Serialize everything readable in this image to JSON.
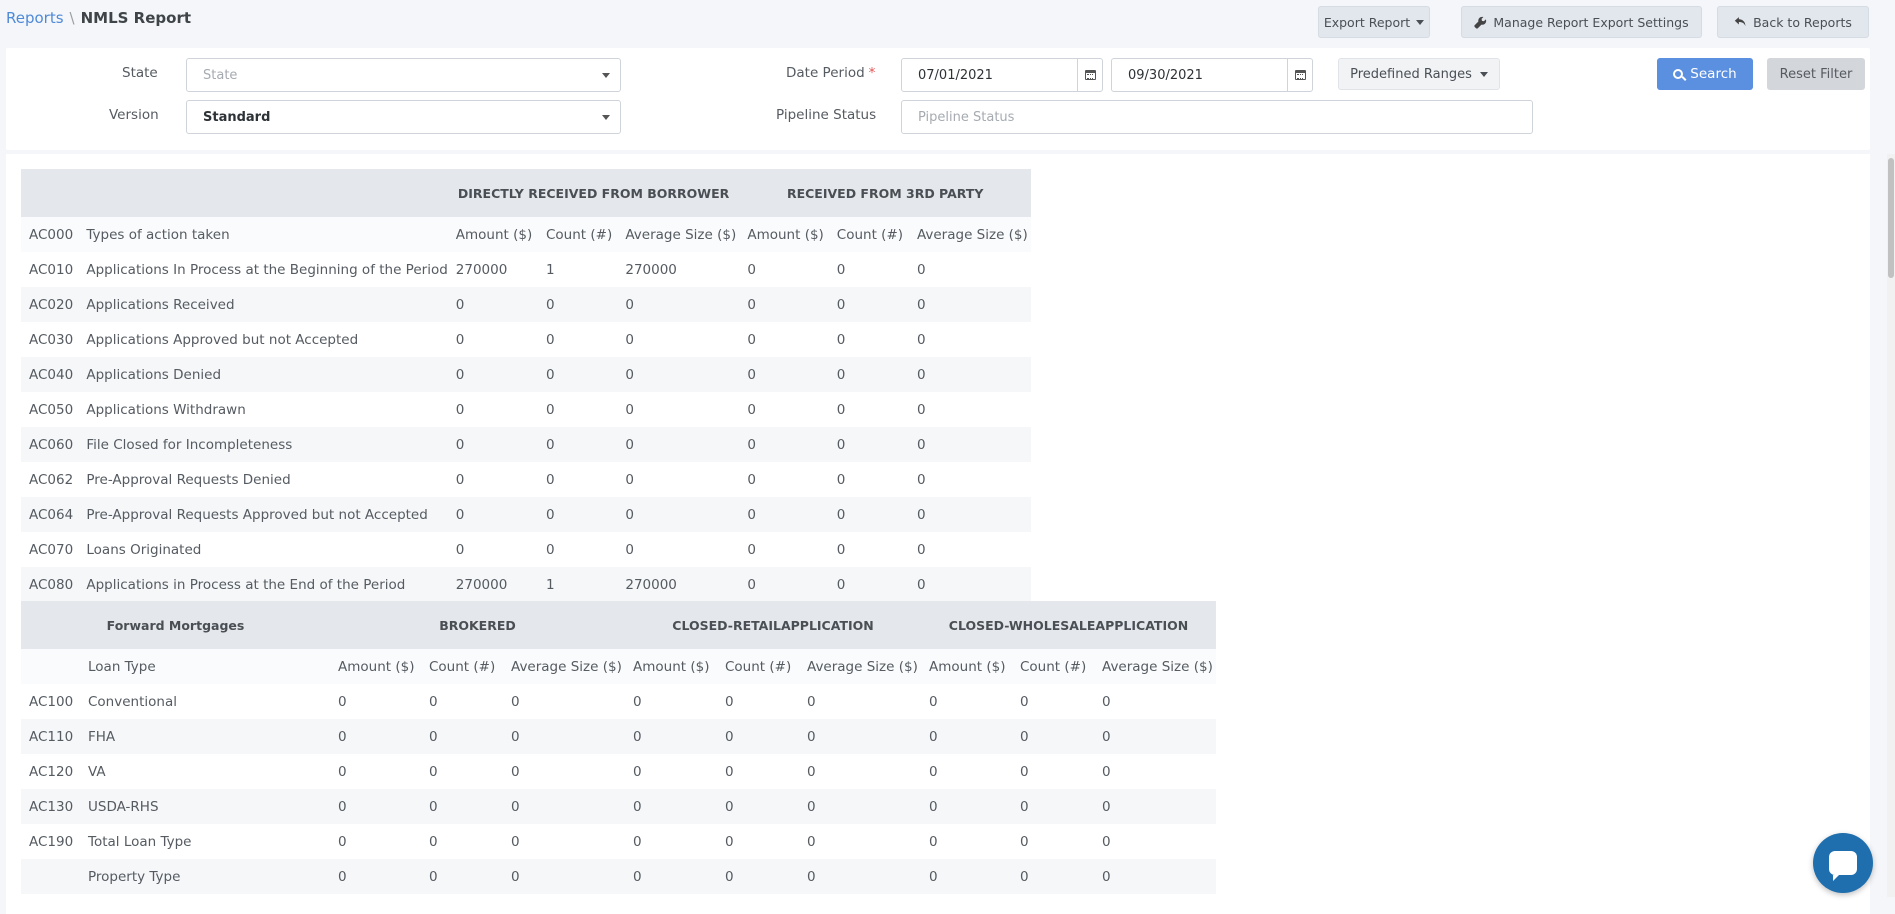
{
  "breadcrumb": {
    "parent": "Reports",
    "separator": "\\",
    "current": "NMLS Report"
  },
  "header_buttons": {
    "export": "Export Report",
    "manage": "Manage Report Export Settings",
    "back": "Back to Reports"
  },
  "filters": {
    "state_label": "State",
    "state_placeholder": "State",
    "version_label": "Version",
    "version_value": "Standard",
    "date_label": "Date Period",
    "date_required": "*",
    "date_from": "07/01/2021",
    "date_to": "09/30/2021",
    "ranges_label": "Predefined Ranges",
    "pipeline_label": "Pipeline Status",
    "pipeline_placeholder": "Pipeline Status",
    "search_label": "Search",
    "reset_label": "Reset Filter"
  },
  "table1": {
    "groups": [
      "DIRECTLY RECEIVED FROM BORROWER",
      "RECEIVED FROM 3RD PARTY"
    ],
    "header": {
      "code": "AC000",
      "label": "Types of action taken",
      "cols": [
        "Amount ($)",
        "Count (#)",
        "Average Size ($)",
        "Amount ($)",
        "Count (#)",
        "Average Size ($)"
      ]
    },
    "rows": [
      {
        "code": "AC010",
        "label": "Applications In Process at the Beginning of the Period",
        "values": [
          "270000",
          "1",
          "270000",
          "0",
          "0",
          "0"
        ]
      },
      {
        "code": "AC020",
        "label": "Applications Received",
        "values": [
          "0",
          "0",
          "0",
          "0",
          "0",
          "0"
        ]
      },
      {
        "code": "AC030",
        "label": "Applications Approved but not Accepted",
        "values": [
          "0",
          "0",
          "0",
          "0",
          "0",
          "0"
        ]
      },
      {
        "code": "AC040",
        "label": "Applications Denied",
        "values": [
          "0",
          "0",
          "0",
          "0",
          "0",
          "0"
        ]
      },
      {
        "code": "AC050",
        "label": "Applications Withdrawn",
        "values": [
          "0",
          "0",
          "0",
          "0",
          "0",
          "0"
        ]
      },
      {
        "code": "AC060",
        "label": "File Closed for Incompleteness",
        "values": [
          "0",
          "0",
          "0",
          "0",
          "0",
          "0"
        ]
      },
      {
        "code": "AC062",
        "label": "Pre-Approval Requests Denied",
        "values": [
          "0",
          "0",
          "0",
          "0",
          "0",
          "0"
        ]
      },
      {
        "code": "AC064",
        "label": "Pre-Approval Requests Approved but not Accepted",
        "values": [
          "0",
          "0",
          "0",
          "0",
          "0",
          "0"
        ]
      },
      {
        "code": "AC070",
        "label": "Loans Originated",
        "values": [
          "0",
          "0",
          "0",
          "0",
          "0",
          "0"
        ]
      },
      {
        "code": "AC080",
        "label": "Applications in Process at the End of the Period",
        "values": [
          "270000",
          "1",
          "270000",
          "0",
          "0",
          "0"
        ]
      }
    ]
  },
  "table2": {
    "groups": [
      "Forward Mortgages",
      "BROKERED",
      "CLOSED-RETAILAPPLICATION",
      "CLOSED-WHOLESALEAPPLICATION"
    ],
    "header": {
      "code": "",
      "label": "Loan Type",
      "cols": [
        "Amount ($)",
        "Count (#)",
        "Average Size ($)",
        "Amount ($)",
        "Count (#)",
        "Average Size ($)",
        "Amount ($)",
        "Count (#)",
        "Average Size ($)"
      ]
    },
    "rows": [
      {
        "code": "AC100",
        "label": "Conventional",
        "values": [
          "0",
          "0",
          "0",
          "0",
          "0",
          "0",
          "0",
          "0",
          "0"
        ]
      },
      {
        "code": "AC110",
        "label": "FHA",
        "values": [
          "0",
          "0",
          "0",
          "0",
          "0",
          "0",
          "0",
          "0",
          "0"
        ]
      },
      {
        "code": "AC120",
        "label": "VA",
        "values": [
          "0",
          "0",
          "0",
          "0",
          "0",
          "0",
          "0",
          "0",
          "0"
        ]
      },
      {
        "code": "AC130",
        "label": "USDA-RHS",
        "values": [
          "0",
          "0",
          "0",
          "0",
          "0",
          "0",
          "0",
          "0",
          "0"
        ]
      },
      {
        "code": "AC190",
        "label": "Total Loan Type",
        "values": [
          "0",
          "0",
          "0",
          "0",
          "0",
          "0",
          "0",
          "0",
          "0"
        ]
      },
      {
        "code": "",
        "label": "Property Type",
        "values": [
          "0",
          "0",
          "0",
          "0",
          "0",
          "0",
          "0",
          "0",
          "0"
        ]
      }
    ]
  }
}
